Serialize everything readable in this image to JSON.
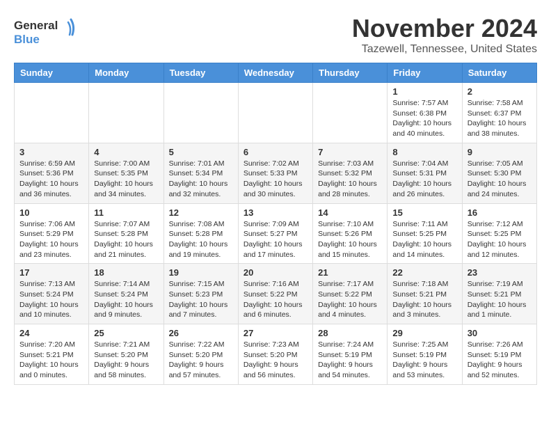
{
  "header": {
    "logo_general": "General",
    "logo_blue": "Blue",
    "title": "November 2024",
    "subtitle": "Tazewell, Tennessee, United States"
  },
  "weekdays": [
    "Sunday",
    "Monday",
    "Tuesday",
    "Wednesday",
    "Thursday",
    "Friday",
    "Saturday"
  ],
  "weeks": [
    [
      {
        "day": "",
        "info": ""
      },
      {
        "day": "",
        "info": ""
      },
      {
        "day": "",
        "info": ""
      },
      {
        "day": "",
        "info": ""
      },
      {
        "day": "",
        "info": ""
      },
      {
        "day": "1",
        "info": "Sunrise: 7:57 AM\nSunset: 6:38 PM\nDaylight: 10 hours\nand 40 minutes."
      },
      {
        "day": "2",
        "info": "Sunrise: 7:58 AM\nSunset: 6:37 PM\nDaylight: 10 hours\nand 38 minutes."
      }
    ],
    [
      {
        "day": "3",
        "info": "Sunrise: 6:59 AM\nSunset: 5:36 PM\nDaylight: 10 hours\nand 36 minutes."
      },
      {
        "day": "4",
        "info": "Sunrise: 7:00 AM\nSunset: 5:35 PM\nDaylight: 10 hours\nand 34 minutes."
      },
      {
        "day": "5",
        "info": "Sunrise: 7:01 AM\nSunset: 5:34 PM\nDaylight: 10 hours\nand 32 minutes."
      },
      {
        "day": "6",
        "info": "Sunrise: 7:02 AM\nSunset: 5:33 PM\nDaylight: 10 hours\nand 30 minutes."
      },
      {
        "day": "7",
        "info": "Sunrise: 7:03 AM\nSunset: 5:32 PM\nDaylight: 10 hours\nand 28 minutes."
      },
      {
        "day": "8",
        "info": "Sunrise: 7:04 AM\nSunset: 5:31 PM\nDaylight: 10 hours\nand 26 minutes."
      },
      {
        "day": "9",
        "info": "Sunrise: 7:05 AM\nSunset: 5:30 PM\nDaylight: 10 hours\nand 24 minutes."
      }
    ],
    [
      {
        "day": "10",
        "info": "Sunrise: 7:06 AM\nSunset: 5:29 PM\nDaylight: 10 hours\nand 23 minutes."
      },
      {
        "day": "11",
        "info": "Sunrise: 7:07 AM\nSunset: 5:28 PM\nDaylight: 10 hours\nand 21 minutes."
      },
      {
        "day": "12",
        "info": "Sunrise: 7:08 AM\nSunset: 5:28 PM\nDaylight: 10 hours\nand 19 minutes."
      },
      {
        "day": "13",
        "info": "Sunrise: 7:09 AM\nSunset: 5:27 PM\nDaylight: 10 hours\nand 17 minutes."
      },
      {
        "day": "14",
        "info": "Sunrise: 7:10 AM\nSunset: 5:26 PM\nDaylight: 10 hours\nand 15 minutes."
      },
      {
        "day": "15",
        "info": "Sunrise: 7:11 AM\nSunset: 5:25 PM\nDaylight: 10 hours\nand 14 minutes."
      },
      {
        "day": "16",
        "info": "Sunrise: 7:12 AM\nSunset: 5:25 PM\nDaylight: 10 hours\nand 12 minutes."
      }
    ],
    [
      {
        "day": "17",
        "info": "Sunrise: 7:13 AM\nSunset: 5:24 PM\nDaylight: 10 hours\nand 10 minutes."
      },
      {
        "day": "18",
        "info": "Sunrise: 7:14 AM\nSunset: 5:24 PM\nDaylight: 10 hours\nand 9 minutes."
      },
      {
        "day": "19",
        "info": "Sunrise: 7:15 AM\nSunset: 5:23 PM\nDaylight: 10 hours\nand 7 minutes."
      },
      {
        "day": "20",
        "info": "Sunrise: 7:16 AM\nSunset: 5:22 PM\nDaylight: 10 hours\nand 6 minutes."
      },
      {
        "day": "21",
        "info": "Sunrise: 7:17 AM\nSunset: 5:22 PM\nDaylight: 10 hours\nand 4 minutes."
      },
      {
        "day": "22",
        "info": "Sunrise: 7:18 AM\nSunset: 5:21 PM\nDaylight: 10 hours\nand 3 minutes."
      },
      {
        "day": "23",
        "info": "Sunrise: 7:19 AM\nSunset: 5:21 PM\nDaylight: 10 hours\nand 1 minute."
      }
    ],
    [
      {
        "day": "24",
        "info": "Sunrise: 7:20 AM\nSunset: 5:21 PM\nDaylight: 10 hours\nand 0 minutes."
      },
      {
        "day": "25",
        "info": "Sunrise: 7:21 AM\nSunset: 5:20 PM\nDaylight: 9 hours\nand 58 minutes."
      },
      {
        "day": "26",
        "info": "Sunrise: 7:22 AM\nSunset: 5:20 PM\nDaylight: 9 hours\nand 57 minutes."
      },
      {
        "day": "27",
        "info": "Sunrise: 7:23 AM\nSunset: 5:20 PM\nDaylight: 9 hours\nand 56 minutes."
      },
      {
        "day": "28",
        "info": "Sunrise: 7:24 AM\nSunset: 5:19 PM\nDaylight: 9 hours\nand 54 minutes."
      },
      {
        "day": "29",
        "info": "Sunrise: 7:25 AM\nSunset: 5:19 PM\nDaylight: 9 hours\nand 53 minutes."
      },
      {
        "day": "30",
        "info": "Sunrise: 7:26 AM\nSunset: 5:19 PM\nDaylight: 9 hours\nand 52 minutes."
      }
    ]
  ]
}
